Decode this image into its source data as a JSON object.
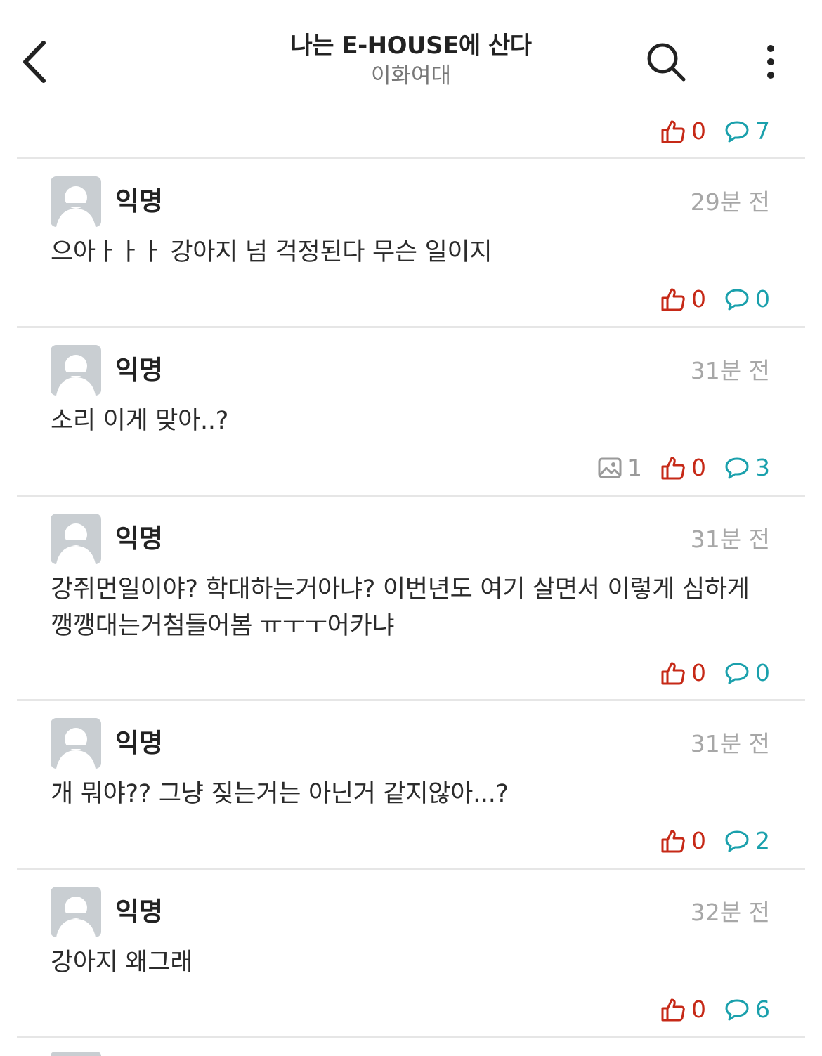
{
  "header": {
    "title": "나는 E-HOUSE에 산다",
    "subtitle": "이화여대"
  },
  "top_partial": {
    "likes": "0",
    "comments": "7"
  },
  "posts": [
    {
      "author": "익명",
      "time": "29분 전",
      "text": "으아ㅏㅏㅏ 강아지 넘 걱정된다 무슨 일이지",
      "images": "",
      "likes": "0",
      "comments": "0"
    },
    {
      "author": "익명",
      "time": "31분 전",
      "text": "소리 이게 맞아..?",
      "images": "1",
      "likes": "0",
      "comments": "3"
    },
    {
      "author": "익명",
      "time": "31분 전",
      "text": "강쥐먼일이야? 학대하는거아냐? 이번년도 여기 살면서 이렇게 심하게 깽깽대는거첨들어봄 ㅠㅜㅜ어카냐",
      "images": "",
      "likes": "0",
      "comments": "0"
    },
    {
      "author": "익명",
      "time": "31분 전",
      "text": "개 뭐야?? 그냥 짖는거는 아닌거 같지않아...?",
      "images": "",
      "likes": "0",
      "comments": "2"
    },
    {
      "author": "익명",
      "time": "32분 전",
      "text": "강아지 왜그래",
      "images": "",
      "likes": "0",
      "comments": "6"
    }
  ],
  "icons": {
    "back": "chevron-left-icon",
    "search": "search-icon",
    "more": "more-vertical-icon",
    "like": "thumbs-up-icon",
    "comment": "comment-bubble-icon",
    "image": "image-icon",
    "avatar": "anonymous-avatar-icon"
  },
  "colors": {
    "like": "#c62917",
    "comment": "#1aa0ac",
    "muted": "#a7a7a7",
    "avatar_bg": "#c9ced2"
  }
}
